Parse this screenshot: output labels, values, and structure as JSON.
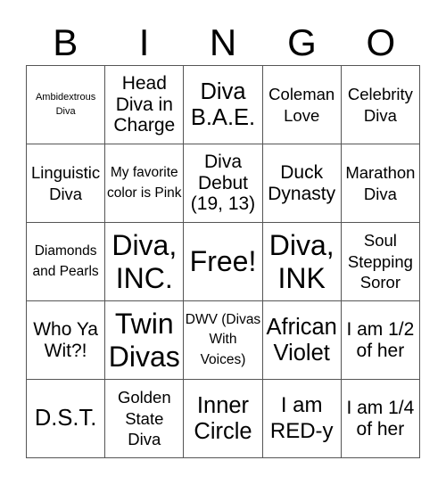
{
  "header": {
    "letters": [
      "B",
      "I",
      "N",
      "G",
      "O"
    ]
  },
  "cells": [
    [
      "Ambidextrous Diva",
      "Head Diva in Charge",
      "Diva B.A.E.",
      "Coleman Love",
      "Celebrity Diva"
    ],
    [
      "Linguistic Diva",
      "My favorite color is Pink",
      "Diva Debut (19, 13)",
      "Duck Dynasty",
      "Marathon Diva"
    ],
    [
      "Diamonds and Pearls",
      "Diva, INC.",
      "Free!",
      "Diva, INK",
      "Soul Stepping Soror"
    ],
    [
      "Who Ya Wit?!",
      "Twin Divas",
      "DWV (Divas With Voices)",
      "African Violet",
      "I am 1/2 of her"
    ],
    [
      "D.S.T.",
      "Golden State Diva",
      "Inner Circle",
      "I am RED-y",
      "I am 1/4 of her"
    ]
  ]
}
